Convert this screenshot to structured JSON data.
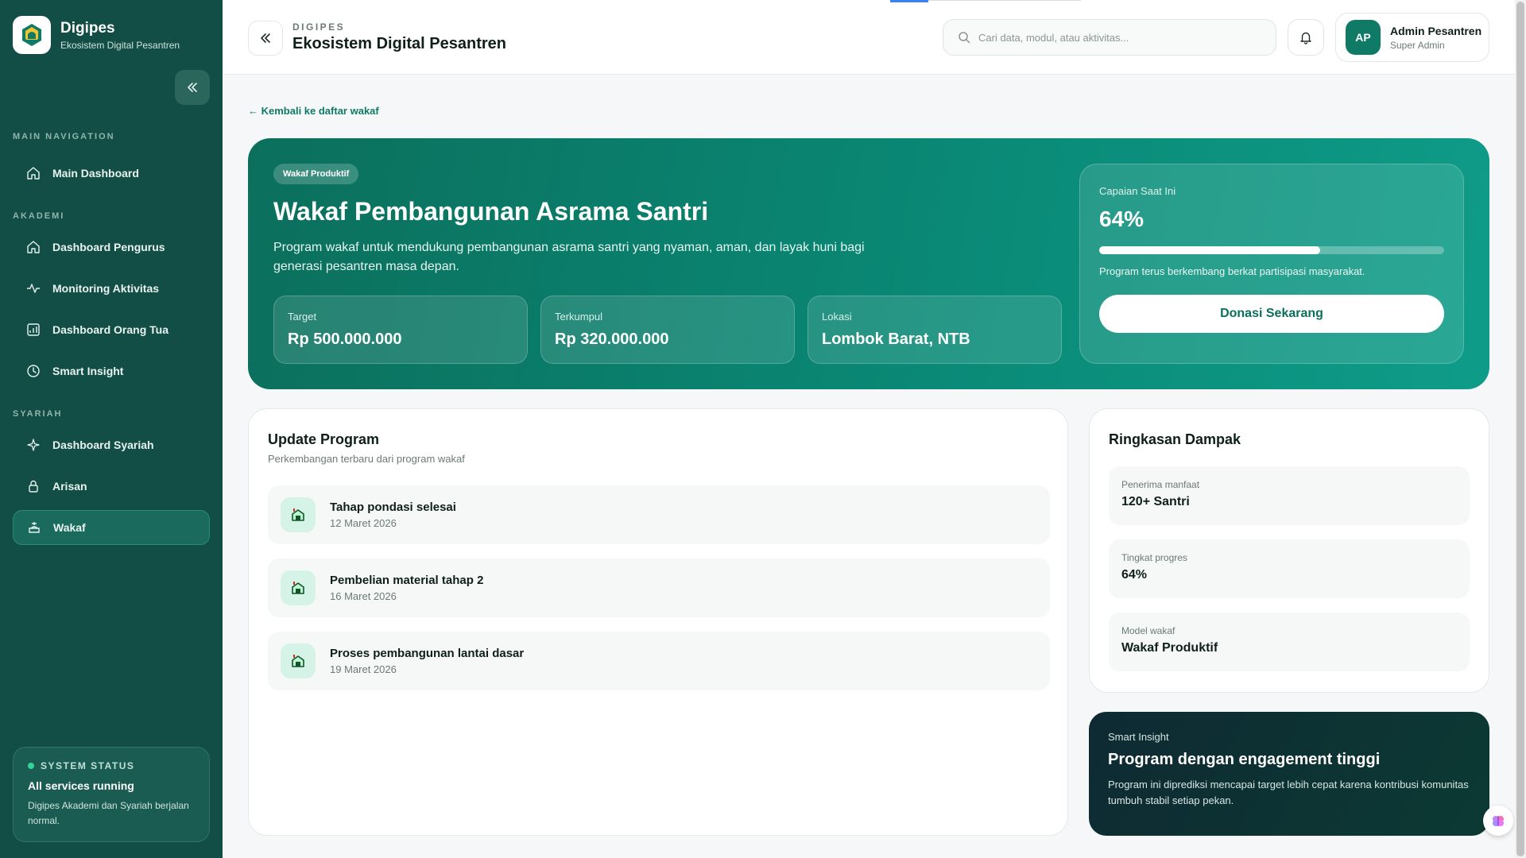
{
  "sidebar": {
    "brand": {
      "title": "Digipes",
      "subtitle": "Ekosistem Digital Pesantren",
      "logo_text": "DIGIPES"
    },
    "sections": [
      {
        "label": "MAIN NAVIGATION",
        "items": [
          {
            "label": "Main Dashboard",
            "icon": "home-icon"
          }
        ]
      },
      {
        "label": "AKADEMI",
        "items": [
          {
            "label": "Dashboard Pengurus",
            "icon": "home-icon"
          },
          {
            "label": "Monitoring Aktivitas",
            "icon": "activity-icon"
          },
          {
            "label": "Dashboard Orang Tua",
            "icon": "chart-icon"
          },
          {
            "label": "Smart Insight",
            "icon": "clock-icon"
          }
        ]
      },
      {
        "label": "SYARIAH",
        "items": [
          {
            "label": "Dashboard Syariah",
            "icon": "sparkle-icon"
          },
          {
            "label": "Arisan",
            "icon": "lock-icon"
          },
          {
            "label": "Wakaf",
            "icon": "wakaf-icon",
            "active": true
          }
        ]
      }
    ],
    "status": {
      "label": "SYSTEM STATUS",
      "title": "All services running",
      "desc": "Digipes Akademi dan Syariah berjalan normal."
    }
  },
  "header": {
    "eyebrow": "DIGIPES",
    "title": "Ekosistem Digital Pesantren",
    "search_placeholder": "Cari data, modul, atau aktivitas...",
    "user": {
      "initials": "AP",
      "name": "Admin Pesantren",
      "role": "Super Admin"
    }
  },
  "main": {
    "back_link": "← Kembali ke daftar wakaf",
    "hero": {
      "badge": "Wakaf Produktif",
      "title": "Wakaf Pembangunan Asrama Santri",
      "desc": "Program wakaf untuk mendukung pembangunan asrama santri yang nyaman, aman, dan layak huni bagi generasi pesantren masa depan.",
      "stats": [
        {
          "label": "Target",
          "value": "Rp 500.000.000"
        },
        {
          "label": "Terkumpul",
          "value": "Rp 320.000.000"
        },
        {
          "label": "Lokasi",
          "value": "Lombok Barat, NTB"
        }
      ],
      "progress": {
        "label": "Capaian Saat Ini",
        "value_text": "64%",
        "value": 64,
        "note": "Program terus berkembang berkat partisipasi masyarakat.",
        "button": "Donasi Sekarang"
      }
    },
    "updates": {
      "title": "Update Program",
      "subtitle": "Perkembangan terbaru dari program wakaf",
      "items": [
        {
          "title": "Tahap pondasi selesai",
          "date": "12 Maret 2026"
        },
        {
          "title": "Pembelian material tahap 2",
          "date": "16 Maret 2026"
        },
        {
          "title": "Proses pembangunan lantai dasar",
          "date": "19 Maret 2026"
        }
      ]
    },
    "impact": {
      "title": "Ringkasan Dampak",
      "items": [
        {
          "label": "Penerima manfaat",
          "value": "120+ Santri"
        },
        {
          "label": "Tingkat progres",
          "value": "64%"
        },
        {
          "label": "Model wakaf",
          "value": "Wakaf Produktif"
        }
      ]
    },
    "insight": {
      "label": "Smart Insight",
      "title": "Program dengan engagement tinggi",
      "desc": "Program ini diprediksi mencapai target lebih cepat karena kontribusi komunitas tumbuh stabil setiap pekan."
    }
  },
  "colors": {
    "sidebar": "#124e45",
    "accent": "#0f7a66",
    "hero": "#0a8b78",
    "insight": "#0e2a33"
  }
}
